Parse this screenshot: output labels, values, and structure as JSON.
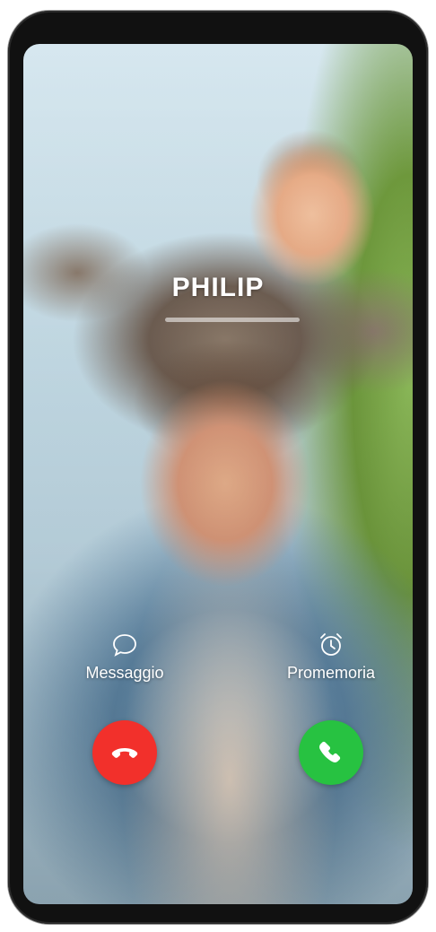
{
  "call": {
    "caller_name": "PHILIP"
  },
  "actions": {
    "message_label": "Messaggio",
    "reminder_label": "Promemoria"
  },
  "buttons": {
    "decline_color": "#f2302b",
    "accept_color": "#27c241"
  },
  "icons": {
    "message": "speech-bubble-icon",
    "reminder": "alarm-clock-icon",
    "decline": "phone-hangup-icon",
    "accept": "phone-icon"
  }
}
